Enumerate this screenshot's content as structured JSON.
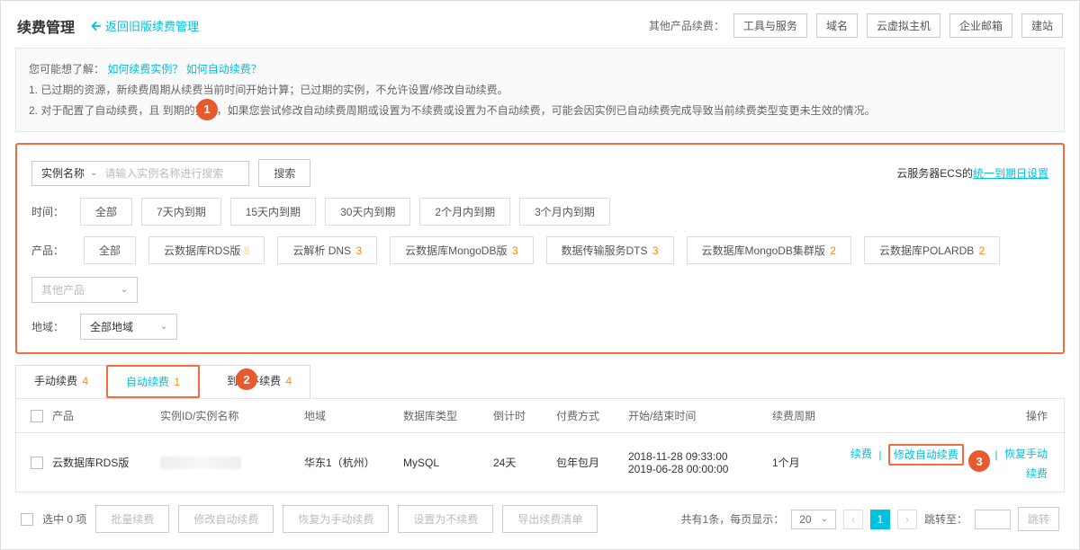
{
  "header": {
    "title": "续费管理",
    "back_link": "返回旧版续费管理",
    "other_label": "其他产品续费：",
    "top_links": [
      "工具与服务",
      "域名",
      "云虚拟主机",
      "企业邮箱",
      "建站"
    ]
  },
  "info": {
    "prefix": "您可能想了解：",
    "link1": "如何续费实例？",
    "link2": "如何自动续费？",
    "line1": "1. 已过期的资源，新续费周期从续费当前时间开始计算；已过期的实例，不允许设置/修改自动续费。",
    "line2": "2. 对于配置了自动续费，且          到期的实例，如果您尝试修改自动续费周期或设置为不续费或设置为不自动续费，可能会因实例已自动续费完成导致当前续费类型变更未生效的情况。"
  },
  "steps": {
    "one": "1",
    "two": "2",
    "three": "3"
  },
  "filters": {
    "name_type": "实例名称",
    "search_placeholder": "请输入实例名称进行搜索",
    "search_btn": "搜索",
    "ecs_prefix": "云服务器ECS的",
    "ecs_link": "统一到期日设置",
    "time_label": "时间：",
    "time_options": [
      "全部",
      "7天内到期",
      "15天内到期",
      "30天内到期",
      "2个月内到期",
      "3个月内到期"
    ],
    "product_label": "产品：",
    "products": [
      {
        "label": "全部",
        "count": ""
      },
      {
        "label": "云数据库RDS版",
        "count": "8"
      },
      {
        "label": "云解析 DNS",
        "count": "3"
      },
      {
        "label": "云数据库MongoDB版",
        "count": "3"
      },
      {
        "label": "数据传输服务DTS",
        "count": "3"
      },
      {
        "label": "云数据库MongoDB集群版",
        "count": "2"
      },
      {
        "label": "云数据库POLARDB",
        "count": "2"
      }
    ],
    "other_products": "其他产品",
    "region_label": "地域：",
    "region_value": "全部地域"
  },
  "tabs": [
    {
      "label": "手动续费",
      "count": "4"
    },
    {
      "label": "自动续费",
      "count": "1"
    },
    {
      "label": "到期不续费",
      "count": "4"
    }
  ],
  "columns": {
    "product": "产品",
    "id": "实例ID/实例名称",
    "region": "地域",
    "dbtype": "数据库类型",
    "countdown": "倒计时",
    "pay": "付费方式",
    "time": "开始/结束时间",
    "cycle": "续费周期",
    "action": "操作"
  },
  "rows": [
    {
      "product": "云数据库RDS版",
      "region": "华东1（杭州）",
      "dbtype": "MySQL",
      "countdown": "24天",
      "pay": "包年包月",
      "start": "2018-11-28 09:33:00",
      "end": "2019-06-28 00:00:00",
      "cycle": "1个月",
      "actions": {
        "renew": "续费",
        "modify": "修改自动续费",
        "restore": "恢复手动续费"
      }
    }
  ],
  "footer": {
    "selected": "选中 0 项",
    "batch": "批量续费",
    "modify": "修改自动续费",
    "restore": "恢复为手动续费",
    "set_norenew": "设置为不续费",
    "export": "导出续费清单",
    "total": "共有1条，每页显示：",
    "page_size": "20",
    "current_page": "1",
    "jump_label": "跳转至：",
    "jump_btn": "跳转"
  }
}
